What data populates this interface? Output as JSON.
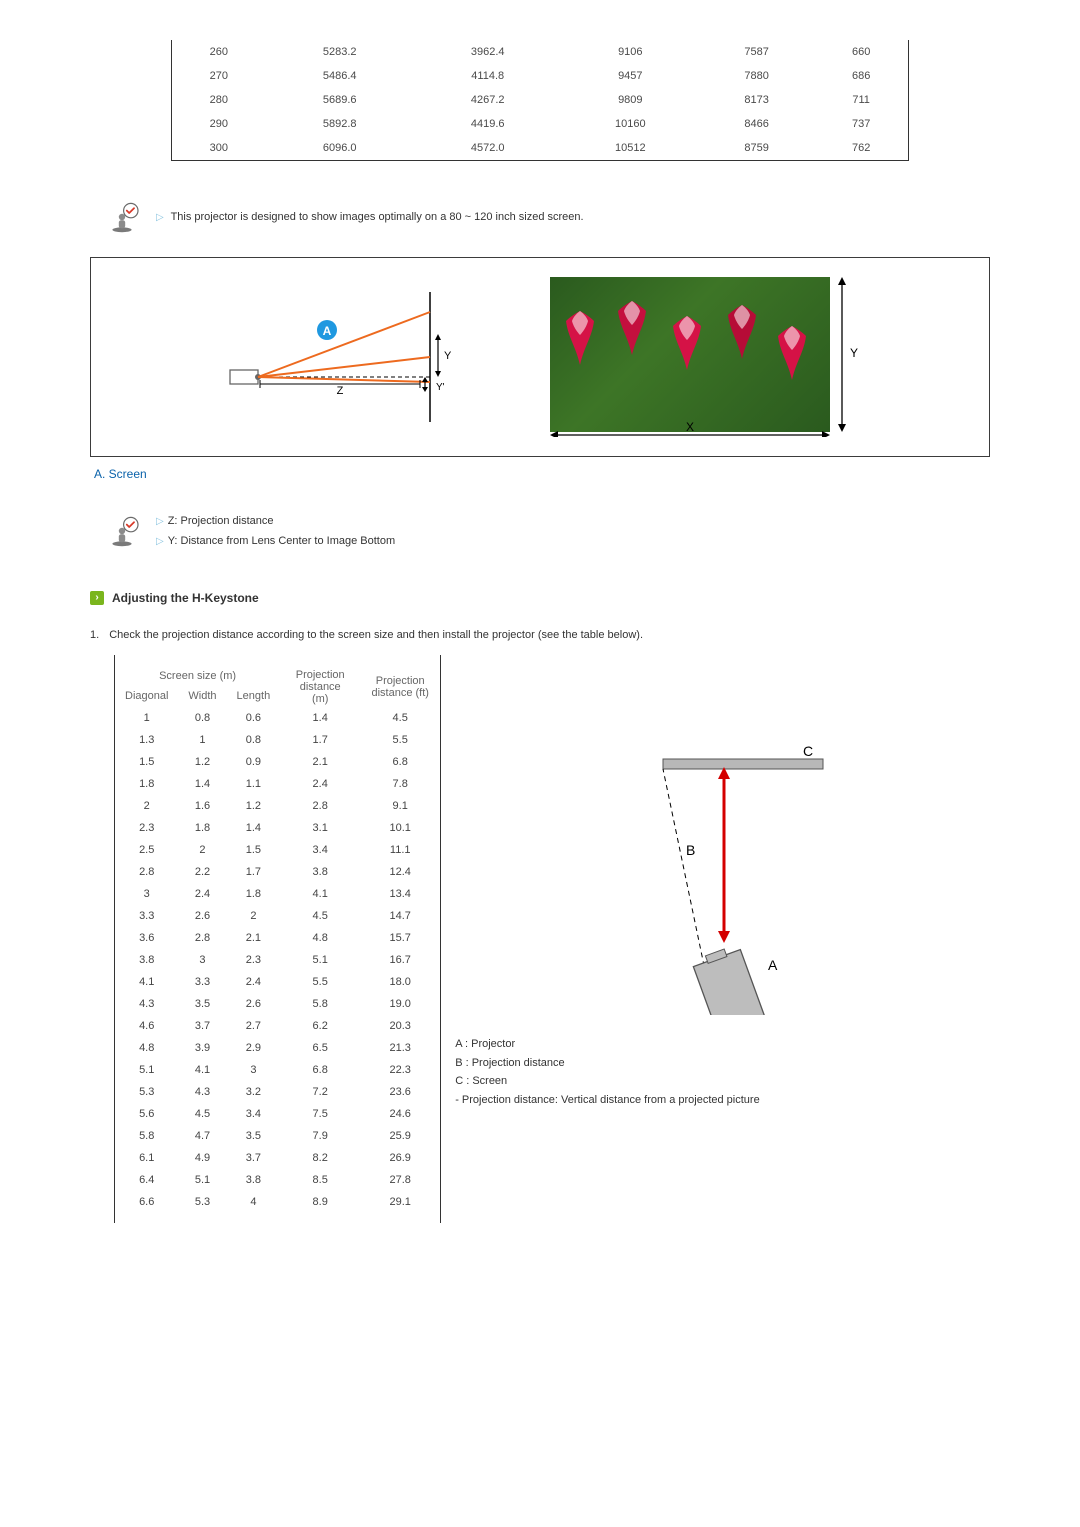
{
  "top_table": {
    "rows": [
      [
        "260",
        "5283.2",
        "3962.4",
        "9106",
        "7587",
        "660"
      ],
      [
        "270",
        "5486.4",
        "4114.8",
        "9457",
        "7880",
        "686"
      ],
      [
        "280",
        "5689.6",
        "4267.2",
        "9809",
        "8173",
        "711"
      ],
      [
        "290",
        "5892.8",
        "4419.6",
        "10160",
        "8466",
        "737"
      ],
      [
        "300",
        "6096.0",
        "4572.0",
        "10512",
        "8759",
        "762"
      ]
    ]
  },
  "note_optimal": "This projector is designed to show images optimally on a 80 ~ 120 inch sized screen.",
  "diagram": {
    "badge": "A",
    "x_label": "X",
    "y_label": "Y",
    "y_prime_label": "Y'",
    "z_label": "Z"
  },
  "screen_label": "A. Screen",
  "definitions": {
    "z": "Z: Projection distance",
    "y": "Y: Distance from Lens Center to Image Bottom"
  },
  "section_title": "Adjusting the H-Keystone",
  "instruction_1": "Check the projection distance according to the screen size and then install the projector (see the table below).",
  "instruction_1_num": "1.",
  "dist_table": {
    "group_headers": [
      "Screen size (m)",
      "Projection distance (m)",
      "Projection distance (ft)"
    ],
    "sub_headers": [
      "Diagonal",
      "Width",
      "Length"
    ],
    "rows": [
      [
        "1",
        "0.8",
        "0.6",
        "1.4",
        "4.5"
      ],
      [
        "1.3",
        "1",
        "0.8",
        "1.7",
        "5.5"
      ],
      [
        "1.5",
        "1.2",
        "0.9",
        "2.1",
        "6.8"
      ],
      [
        "1.8",
        "1.4",
        "1.1",
        "2.4",
        "7.8"
      ],
      [
        "2",
        "1.6",
        "1.2",
        "2.8",
        "9.1"
      ],
      [
        "2.3",
        "1.8",
        "1.4",
        "3.1",
        "10.1"
      ],
      [
        "2.5",
        "2",
        "1.5",
        "3.4",
        "11.1"
      ],
      [
        "2.8",
        "2.2",
        "1.7",
        "3.8",
        "12.4"
      ],
      [
        "3",
        "2.4",
        "1.8",
        "4.1",
        "13.4"
      ],
      [
        "3.3",
        "2.6",
        "2",
        "4.5",
        "14.7"
      ],
      [
        "3.6",
        "2.8",
        "2.1",
        "4.8",
        "15.7"
      ],
      [
        "3.8",
        "3",
        "2.3",
        "5.1",
        "16.7"
      ],
      [
        "4.1",
        "3.3",
        "2.4",
        "5.5",
        "18.0"
      ],
      [
        "4.3",
        "3.5",
        "2.6",
        "5.8",
        "19.0"
      ],
      [
        "4.6",
        "3.7",
        "2.7",
        "6.2",
        "20.3"
      ],
      [
        "4.8",
        "3.9",
        "2.9",
        "6.5",
        "21.3"
      ],
      [
        "5.1",
        "4.1",
        "3",
        "6.8",
        "22.3"
      ],
      [
        "5.3",
        "4.3",
        "3.2",
        "7.2",
        "23.6"
      ],
      [
        "5.6",
        "4.5",
        "3.4",
        "7.5",
        "24.6"
      ],
      [
        "5.8",
        "4.7",
        "3.5",
        "7.9",
        "25.9"
      ],
      [
        "6.1",
        "4.9",
        "3.7",
        "8.2",
        "26.9"
      ],
      [
        "6.4",
        "5.1",
        "3.8",
        "8.5",
        "27.8"
      ],
      [
        "6.6",
        "5.3",
        "4",
        "8.9",
        "29.1"
      ]
    ]
  },
  "keystone_labels": {
    "A": "A",
    "B": "B",
    "C": "C"
  },
  "legend": {
    "a": "A : Projector",
    "b": "B : Projection distance",
    "c": "C : Screen",
    "note": "- Projection distance: Vertical distance from a projected picture"
  }
}
